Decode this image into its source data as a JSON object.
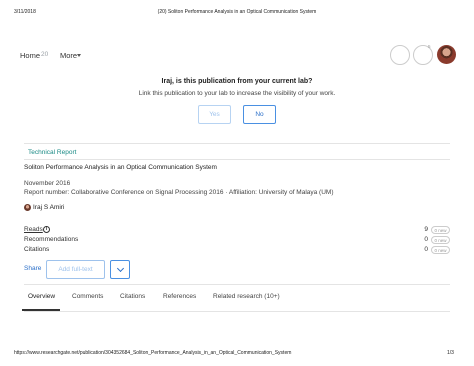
{
  "print": {
    "date": "3/11/2018",
    "title": "(20) Soliton Performance Analysis in an Optical Communication System",
    "url": "https://www.researchgate.net/publication/304352684_Soliton_Performance_Analysis_in_an_Optical_Communication_System",
    "page": "1/3"
  },
  "nav": {
    "home_label": "Home",
    "home_count": "20",
    "more_label": "More",
    "badge_count": "5"
  },
  "lab_prompt": {
    "title": "Iraj, is this publication from your current lab?",
    "subtitle": "Link this publication to your lab to increase the visibility of your work.",
    "yes_label": "Yes",
    "no_label": "No"
  },
  "publication": {
    "type": "Technical Report",
    "title": "Soliton Performance Analysis in an Optical Communication System",
    "date": "November 2016",
    "report": "Report number: Collaborative Conference on Signal Processing 2016 · Affiliation: University of Malaya (UM)",
    "author": "Iraj S Amiri"
  },
  "stats": [
    {
      "label": "Reads",
      "value": "9",
      "badge": "0 new"
    },
    {
      "label": "Recommendations",
      "value": "0",
      "badge": "0 new"
    },
    {
      "label": "Citations",
      "value": "0",
      "badge": "0 new"
    }
  ],
  "actions": {
    "share_label": "Share",
    "add_fulltext_label": "Add full-text"
  },
  "tabs": [
    {
      "label": "Overview",
      "active": true
    },
    {
      "label": "Comments"
    },
    {
      "label": "Citations"
    },
    {
      "label": "References"
    },
    {
      "label": "Related research (10+)"
    }
  ],
  "icons": {
    "info": "info-icon",
    "dropdown": "chevron-down-icon",
    "more_caret": "caret-down-icon"
  },
  "colors": {
    "accent": "#2a6fc9",
    "report_type": "#1a8a85"
  }
}
